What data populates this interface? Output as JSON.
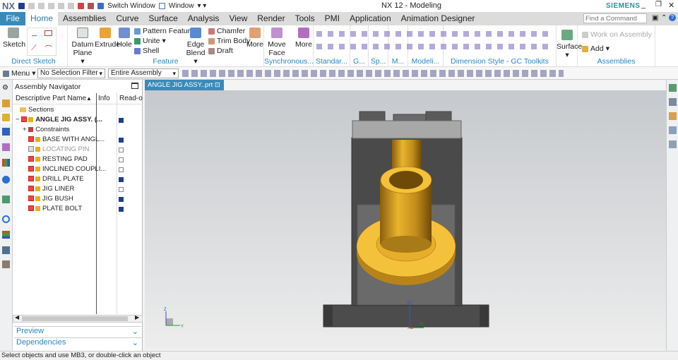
{
  "title": {
    "app": "NX",
    "window_title": "NX 12 - Modeling",
    "brand": "SIEMENS",
    "switch_window": "Switch Window",
    "window_menu": "Window"
  },
  "tabs": [
    "File",
    "Home",
    "Assemblies",
    "Curve",
    "Surface",
    "Analysis",
    "View",
    "Render",
    "Tools",
    "PMI",
    "Application",
    "Animation Designer"
  ],
  "search_placeholder": "Find a Command",
  "ribbon": {
    "sketch": "Sketch",
    "direct_sketch": "Direct Sketch",
    "datum_plane": "Datum Plane",
    "extrude": "Extrude",
    "hole": "Hole",
    "pattern_feature": "Pattern Feature",
    "unite": "Unite",
    "shell": "Shell",
    "edge_blend": "Edge Blend",
    "chamfer": "Chamfer",
    "trim_body": "Trim Body",
    "draft": "Draft",
    "more": "More",
    "feature": "Feature",
    "move_face": "Move Face",
    "more2": "More",
    "synchronous": "Synchronous...",
    "standard": "Standar...",
    "g": "G...",
    "sp": "Sp...",
    "m": "M...",
    "modeli": "Modeli...",
    "dim_style": "Dimension Style - GC Toolkits",
    "surface": "Surface",
    "work_on_assembly": "Work on Assembly",
    "add": "Add",
    "assemblies": "Assemblies"
  },
  "toolbar": {
    "menu": "Menu",
    "selection_filter": "No Selection Filter",
    "scope": "Entire Assembly"
  },
  "navigator": {
    "title": "Assembly Navigator",
    "columns": [
      "Descriptive Part Name",
      "Info",
      "Read-o"
    ],
    "rows": [
      {
        "name": "Sections",
        "readonly": ""
      },
      {
        "name": "ANGLE JIG ASSY. (...",
        "readonly": "disk"
      },
      {
        "name": "Constraints",
        "readonly": ""
      },
      {
        "name": "BASE WITH ANGL...",
        "readonly": "disk"
      },
      {
        "name": "LOCATING PIN",
        "readonly": "box"
      },
      {
        "name": "RESTING PAD",
        "readonly": "box"
      },
      {
        "name": "INCLINED COUPLI...",
        "readonly": "box"
      },
      {
        "name": "DRILL PLATE",
        "readonly": "disk"
      },
      {
        "name": "JIG LINER",
        "readonly": "box"
      },
      {
        "name": "JIG BUSH",
        "readonly": "disk"
      },
      {
        "name": "PLATE BOLT",
        "readonly": "disk"
      }
    ],
    "preview": "Preview",
    "dependencies": "Dependencies"
  },
  "viewport": {
    "tab": "ANGLE JIG ASSY..prt",
    "axis_z": "ZC",
    "axis_y": "YC",
    "axis_x": "XC",
    "small_y": "Y",
    "small_z": "Z"
  },
  "status": "Select objects and use MB3, or double-click an object",
  "colors": {
    "accent": "#3a8ab8",
    "part": "#e8b52a",
    "body": "#4a4a4a"
  }
}
